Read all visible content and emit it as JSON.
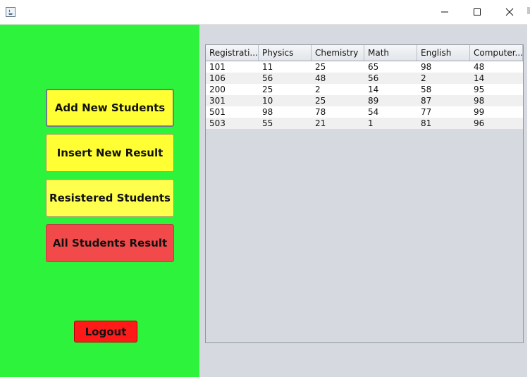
{
  "titlebar": {
    "icons": {
      "app": "java-app-icon",
      "minimize": "minimize-icon",
      "maximize": "maximize-icon",
      "close": "close-icon"
    }
  },
  "sidebar": {
    "buttons": [
      {
        "label": "Add New Students"
      },
      {
        "label": "Insert New Result"
      },
      {
        "label": "Resistered Students"
      },
      {
        "label": "All Students Result"
      }
    ],
    "logout_label": "Logout",
    "colors": {
      "background": "#2ef33c",
      "yellow": "#ffff33",
      "red": "#f24a4a",
      "logout": "#ff1a1a"
    }
  },
  "table": {
    "columns": [
      "Registrati...",
      "Physics",
      "Chemistry",
      "Math",
      "English",
      "Computer..."
    ],
    "rows": [
      [
        "101",
        "11",
        "25",
        "65",
        "98",
        "48"
      ],
      [
        "106",
        "56",
        "48",
        "56",
        "2",
        "14"
      ],
      [
        "200",
        "25",
        "2",
        "14",
        "58",
        "95"
      ],
      [
        "301",
        "10",
        "25",
        "89",
        "87",
        "98"
      ],
      [
        "501",
        "98",
        "78",
        "54",
        "77",
        "99"
      ],
      [
        "503",
        "55",
        "21",
        "1",
        "81",
        "96"
      ]
    ]
  }
}
